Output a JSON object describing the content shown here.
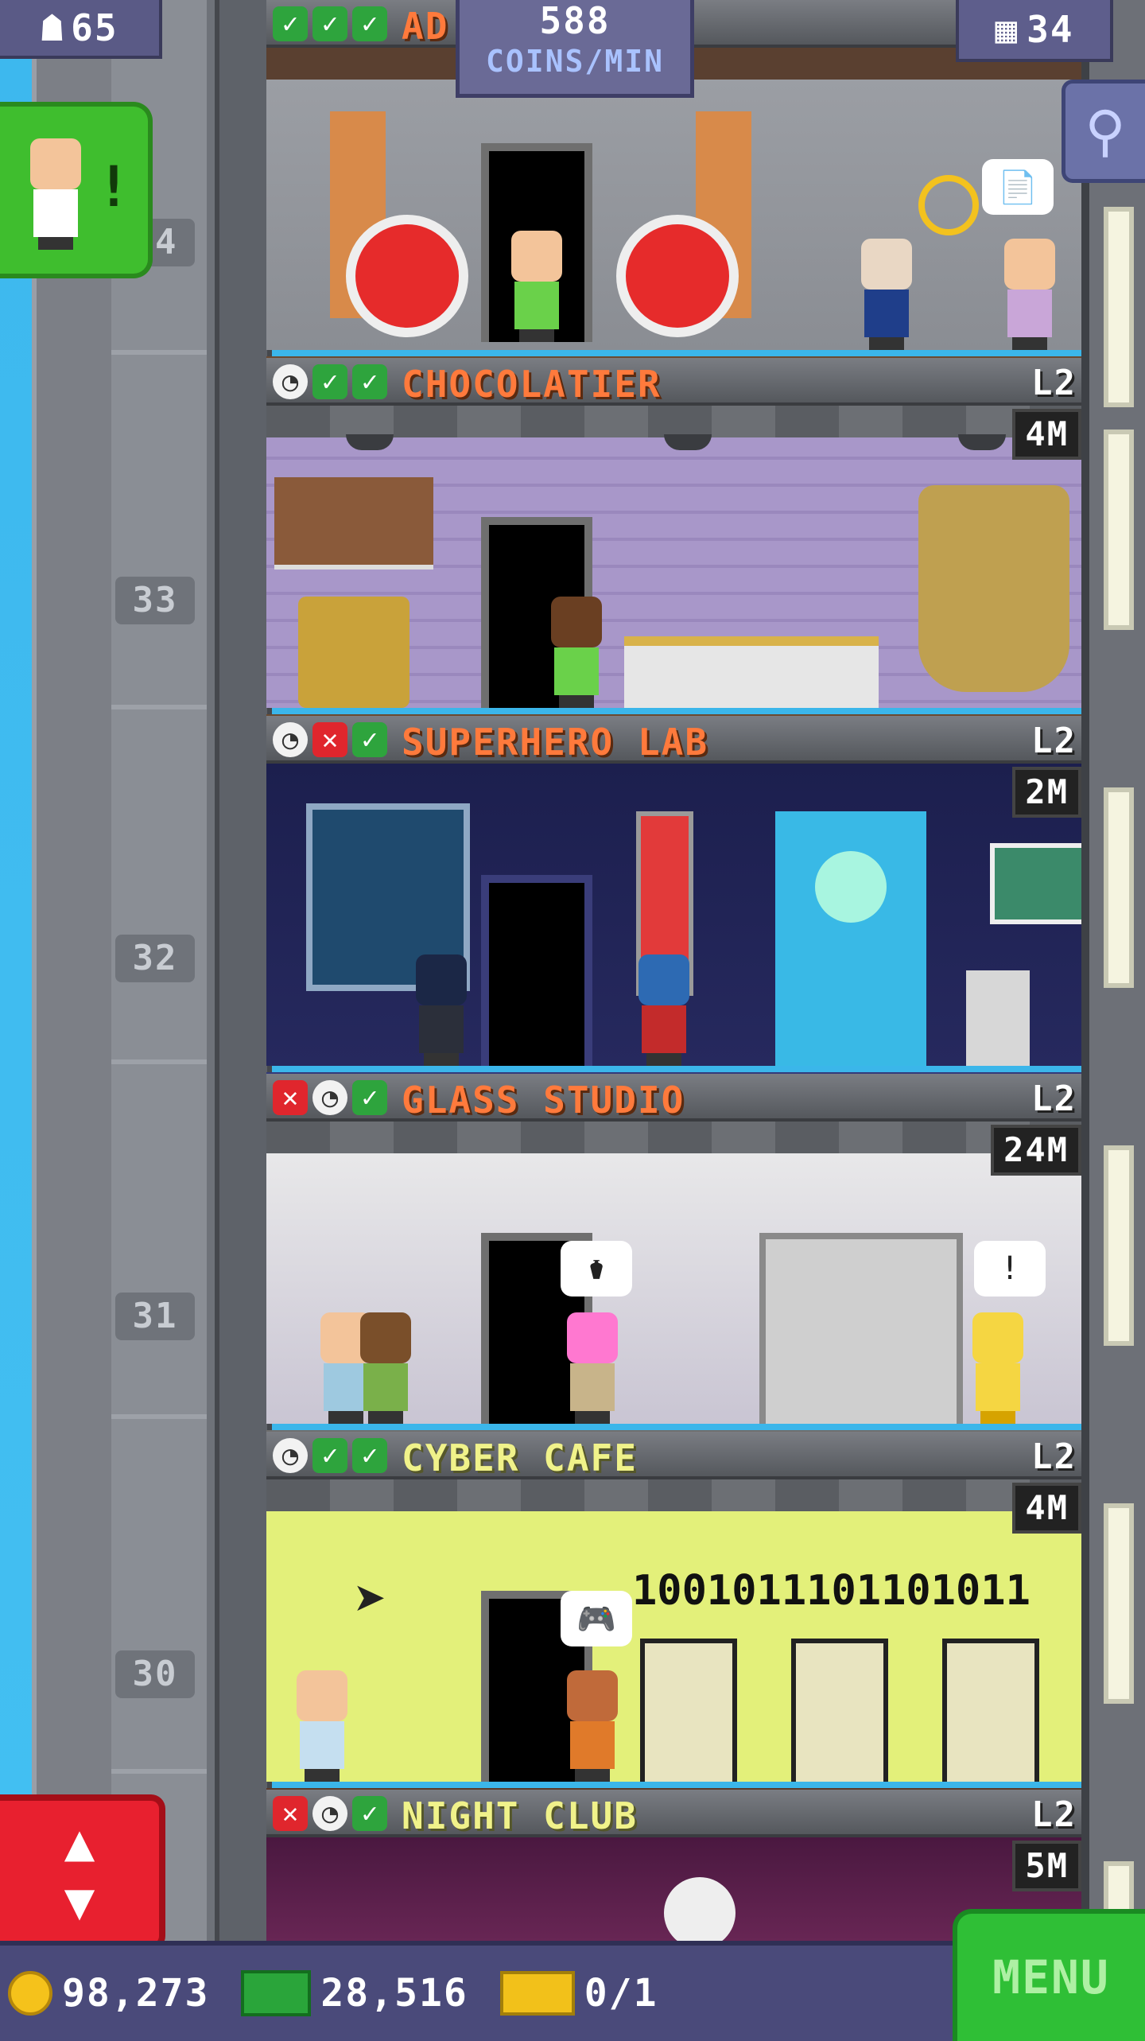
{
  "hud": {
    "population": "65",
    "coins_rate_value": "588",
    "coins_rate_label": "COINS/MIN",
    "floor_count": "34"
  },
  "elevator": {
    "floor_numbers": [
      "34",
      "33",
      "32",
      "31",
      "30"
    ]
  },
  "floors": [
    {
      "name": "AD",
      "level": "",
      "stock": "",
      "status": [
        "ok",
        "ok",
        "ok"
      ],
      "title_color": "#ff7a3c"
    },
    {
      "name": "CHOCOLATIER",
      "level": "L2",
      "stock": "4M",
      "status": [
        "clock",
        "ok",
        "ok"
      ],
      "title_color": "#ff7a3c"
    },
    {
      "name": "SUPERHERO LAB",
      "level": "L2",
      "stock": "2M",
      "status": [
        "clock",
        "no",
        "ok"
      ],
      "title_color": "#ff7a3c"
    },
    {
      "name": "GLASS STUDIO",
      "level": "L2",
      "stock": "24M",
      "status": [
        "no",
        "clock",
        "ok"
      ],
      "title_color": "#ff7a3c"
    },
    {
      "name": "CYBER CAFE",
      "level": "L2",
      "stock": "4M",
      "status": [
        "clock",
        "ok",
        "ok"
      ],
      "title_color": "#f0f28a"
    },
    {
      "name": "NIGHT CLUB",
      "level": "L2",
      "stock": "5M",
      "status": [
        "no",
        "clock",
        "ok"
      ],
      "title_color": "#f0f28a"
    }
  ],
  "cyber_cafe": {
    "binary_text": "1001011101101011"
  },
  "speech": {
    "glass_customer": "⚱",
    "glass_alert": "!",
    "cafe_customer": "🎮"
  },
  "bottom": {
    "coins": "98,273",
    "bux": "28,516",
    "tickets": "0/1",
    "menu_label": "MENU"
  },
  "colors": {
    "accent_orange": "#ff7a3c",
    "accent_yellow": "#f0f28a",
    "menu_green": "#2fbf36",
    "elevator_red": "#e8202f"
  }
}
